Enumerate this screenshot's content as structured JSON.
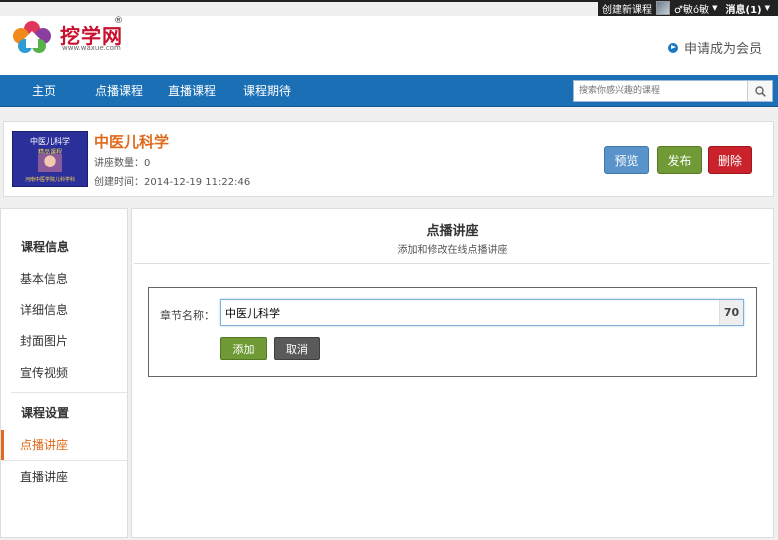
{
  "userbar": {
    "create_course": "创建新课程",
    "username": "♂敏ó敏",
    "messages": "消息(1)"
  },
  "header": {
    "logo_text": "挖学网",
    "logo_url": "www.waxue.com",
    "join_member": "申请成为会员"
  },
  "nav": {
    "items": [
      "主页",
      "点播课程",
      "直播课程",
      "课程期待"
    ],
    "search_placeholder": "搜索你感兴趣的课程"
  },
  "course": {
    "cover_line1": "中医儿科学",
    "cover_line2": "精品课程",
    "cover_line3": "河南中医学院儿科学科",
    "title": "中医儿科学",
    "lecture_count": "讲座数量：0",
    "created": "创建时间：2014-12-19 11:22:46",
    "preview": "预览",
    "publish": "发布",
    "delete": "删除"
  },
  "sidebar": {
    "section1": "课程信息",
    "items1": [
      "基本信息",
      "详细信息",
      "封面图片",
      "宣传视频"
    ],
    "section2": "课程设置",
    "items2": [
      "点播讲座",
      "直播讲座"
    ]
  },
  "main": {
    "title": "点播讲座",
    "subtitle": "添加和修改在线点播讲座",
    "label": "章节名称：",
    "input_value": "中医儿科学",
    "char_count": "70",
    "add": "添加",
    "cancel": "取消"
  },
  "colors": {
    "nav_blue": "#1a6fb5",
    "accent_orange": "#e06a1a",
    "green": "#6f9a36",
    "red": "#c9222a"
  }
}
